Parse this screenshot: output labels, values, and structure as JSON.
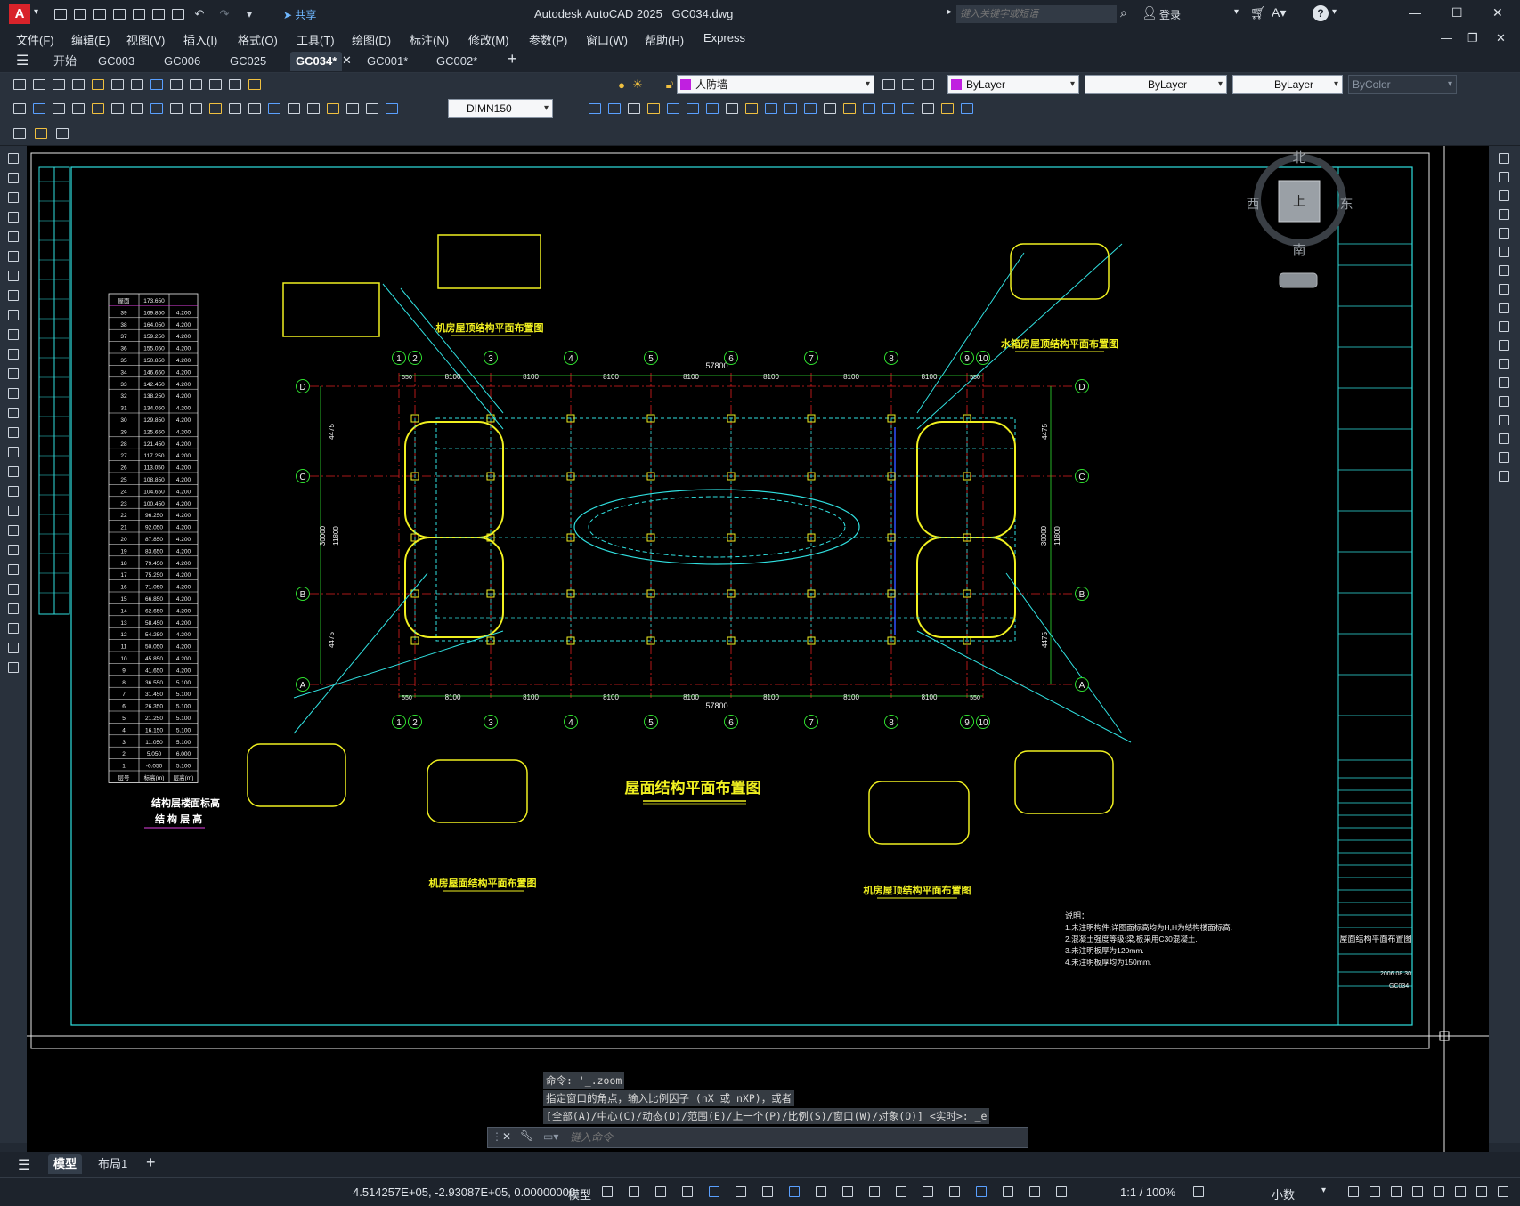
{
  "app": {
    "title": "Autodesk AutoCAD 2025",
    "document": "GC034.dwg",
    "share_label": "共享",
    "search_placeholder": "键入关键字或短语",
    "login_label": "登录"
  },
  "menu": [
    "文件(F)",
    "编辑(E)",
    "视图(V)",
    "插入(I)",
    "格式(O)",
    "工具(T)",
    "绘图(D)",
    "标注(N)",
    "修改(M)",
    "参数(P)",
    "窗口(W)",
    "帮助(H)",
    "Express"
  ],
  "tabs": [
    {
      "label": "开始"
    },
    {
      "label": "GC003"
    },
    {
      "label": "GC006"
    },
    {
      "label": "GC025"
    },
    {
      "label": "GC034*",
      "active": true
    },
    {
      "label": "GC001*"
    },
    {
      "label": "GC002*"
    }
  ],
  "toolbar": {
    "layer_name": "人防墙",
    "layer_color": "#c020e0",
    "color_value": "ByLayer",
    "linetype_value": "ByLayer",
    "lineweight_value": "ByLayer",
    "plotstyle_value": "ByColor",
    "dimstyle_value": "DIMN150"
  },
  "viewcube": {
    "north": "北",
    "south": "南",
    "east": "东",
    "west": "西",
    "face": "上"
  },
  "drawing": {
    "main_title": "屋面结构平面布置图",
    "dim_total": "57800",
    "dim_bay": "8100",
    "dim_end": "550",
    "grid_cols": [
      "1",
      "2",
      "3",
      "4",
      "5",
      "6",
      "7",
      "8",
      "9",
      "10"
    ],
    "grid_rows": [
      "D",
      "C",
      "B",
      "A"
    ],
    "side_dims": [
      "4475",
      "30000",
      "11800",
      "4475"
    ],
    "inset_titles": [
      "机房屋顶结构平面布置图",
      "水箱房屋顶结构平面布置图",
      "机房屋面结构平面布置图",
      "机房屋顶结构平面布置图"
    ],
    "table_caption_1": "结构层楼面标高",
    "table_caption_2": "结 构 层 高",
    "table_header": [
      "层号",
      "标高(m)",
      "层高(m)"
    ],
    "table_rows": [
      [
        "屋面",
        "173.650",
        ""
      ],
      [
        "39",
        "169.850",
        "4.200"
      ],
      [
        "38",
        "164.050",
        "4.200"
      ],
      [
        "37",
        "159.250",
        "4.200"
      ],
      [
        "36",
        "155.050",
        "4.200"
      ],
      [
        "35",
        "150.850",
        "4.200"
      ],
      [
        "34",
        "146.650",
        "4.200"
      ],
      [
        "33",
        "142.450",
        "4.200"
      ],
      [
        "32",
        "138.250",
        "4.200"
      ],
      [
        "31",
        "134.050",
        "4.200"
      ],
      [
        "30",
        "129.850",
        "4.200"
      ],
      [
        "29",
        "125.650",
        "4.200"
      ],
      [
        "28",
        "121.450",
        "4.200"
      ],
      [
        "27",
        "117.250",
        "4.200"
      ],
      [
        "26",
        "113.050",
        "4.200"
      ],
      [
        "25",
        "108.850",
        "4.200"
      ],
      [
        "24",
        "104.650",
        "4.200"
      ],
      [
        "23",
        "100.450",
        "4.200"
      ],
      [
        "22",
        "96.250",
        "4.200"
      ],
      [
        "21",
        "92.050",
        "4.200"
      ],
      [
        "20",
        "87.850",
        "4.200"
      ],
      [
        "19",
        "83.650",
        "4.200"
      ],
      [
        "18",
        "79.450",
        "4.200"
      ],
      [
        "17",
        "75.250",
        "4.200"
      ],
      [
        "16",
        "71.050",
        "4.200"
      ],
      [
        "15",
        "66.850",
        "4.200"
      ],
      [
        "14",
        "62.650",
        "4.200"
      ],
      [
        "13",
        "58.450",
        "4.200"
      ],
      [
        "12",
        "54.250",
        "4.200"
      ],
      [
        "11",
        "50.050",
        "4.200"
      ],
      [
        "10",
        "45.850",
        "4.200"
      ],
      [
        "9",
        "41.650",
        "4.200"
      ],
      [
        "8",
        "36.550",
        "5.100"
      ],
      [
        "7",
        "31.450",
        "5.100"
      ],
      [
        "6",
        "26.350",
        "5.100"
      ],
      [
        "5",
        "21.250",
        "5.100"
      ],
      [
        "4",
        "16.150",
        "5.100"
      ],
      [
        "3",
        "11.050",
        "5.100"
      ],
      [
        "2",
        "5.050",
        "6.000"
      ],
      [
        "1",
        "-0.050",
        "5.100"
      ]
    ],
    "notes_title": "说明：",
    "notes": [
      "1.未注明构件,详图面标高均为H,H为结构楼面标高.",
      "2.混凝土强度等级:梁,板采用C30混凝土.",
      "3.未注明板厚为120mm.",
      "4.未注明板厚均为150mm."
    ],
    "titleblock_name": "屋面结构平面布置图",
    "titleblock_no": "GC034",
    "titleblock_date": "2006.08.30"
  },
  "command": {
    "lines": [
      "命令: '_.zoom",
      "指定窗口的角点，输入比例因子 (nX 或 nXP)，或者",
      "[全部(A)/中心(C)/动态(D)/范围(E)/上一个(P)/比例(S)/窗口(W)/对象(O)] <实时>: _e"
    ],
    "placeholder": "键入命令"
  },
  "layout_tabs": [
    {
      "label": "模型",
      "active": true
    },
    {
      "label": "布局1"
    }
  ],
  "status": {
    "coords": "4.514257E+05, -2.93087E+05, 0.00000000",
    "model": "模型",
    "scale": "1:1 / 100%",
    "units": "小数"
  }
}
